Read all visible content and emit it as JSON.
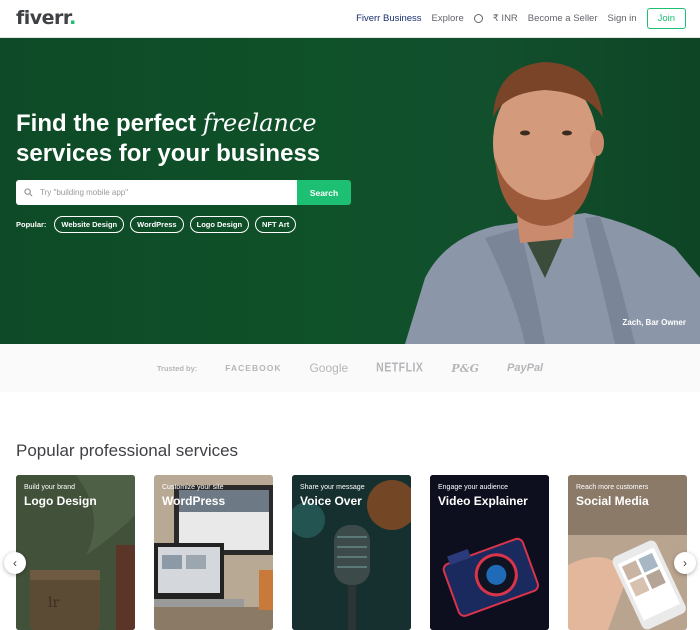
{
  "header": {
    "logo": "fiverr",
    "logo_dot": ".",
    "nav": {
      "business": "Fiverr Business",
      "explore": "Explore",
      "currency": "₹ INR",
      "become_seller": "Become a Seller",
      "sign_in": "Sign in",
      "join": "Join"
    }
  },
  "hero": {
    "title_line1_prefix": "Find the perfect ",
    "title_line1_italic": "freelance",
    "title_line2": "services for your business",
    "search_placeholder": "Try \"building mobile app\"",
    "search_button": "Search",
    "popular_label": "Popular:",
    "popular_tags": [
      "Website Design",
      "WordPress",
      "Logo Design",
      "NFT Art"
    ],
    "caption": "Zach, Bar Owner"
  },
  "trusted": {
    "label": "Trusted by:",
    "brands": [
      "FACEBOOK",
      "Google",
      "NETFLIX",
      "P&G",
      "PayPal"
    ]
  },
  "services": {
    "title": "Popular professional services",
    "cards": [
      {
        "subtitle": "Build your brand",
        "title": "Logo Design"
      },
      {
        "subtitle": "Customize your site",
        "title": "WordPress"
      },
      {
        "subtitle": "Share your message",
        "title": "Voice Over"
      },
      {
        "subtitle": "Engage your audience",
        "title": "Video Explainer"
      },
      {
        "subtitle": "Reach more customers",
        "title": "Social Media"
      }
    ]
  },
  "colors": {
    "brand_green": "#1dbf73",
    "hero_green": "#0f5129",
    "text_dark": "#404145"
  },
  "icons": {
    "search": "search-icon",
    "globe": "globe-icon",
    "prev": "chevron-left-icon",
    "next": "chevron-right-icon"
  }
}
